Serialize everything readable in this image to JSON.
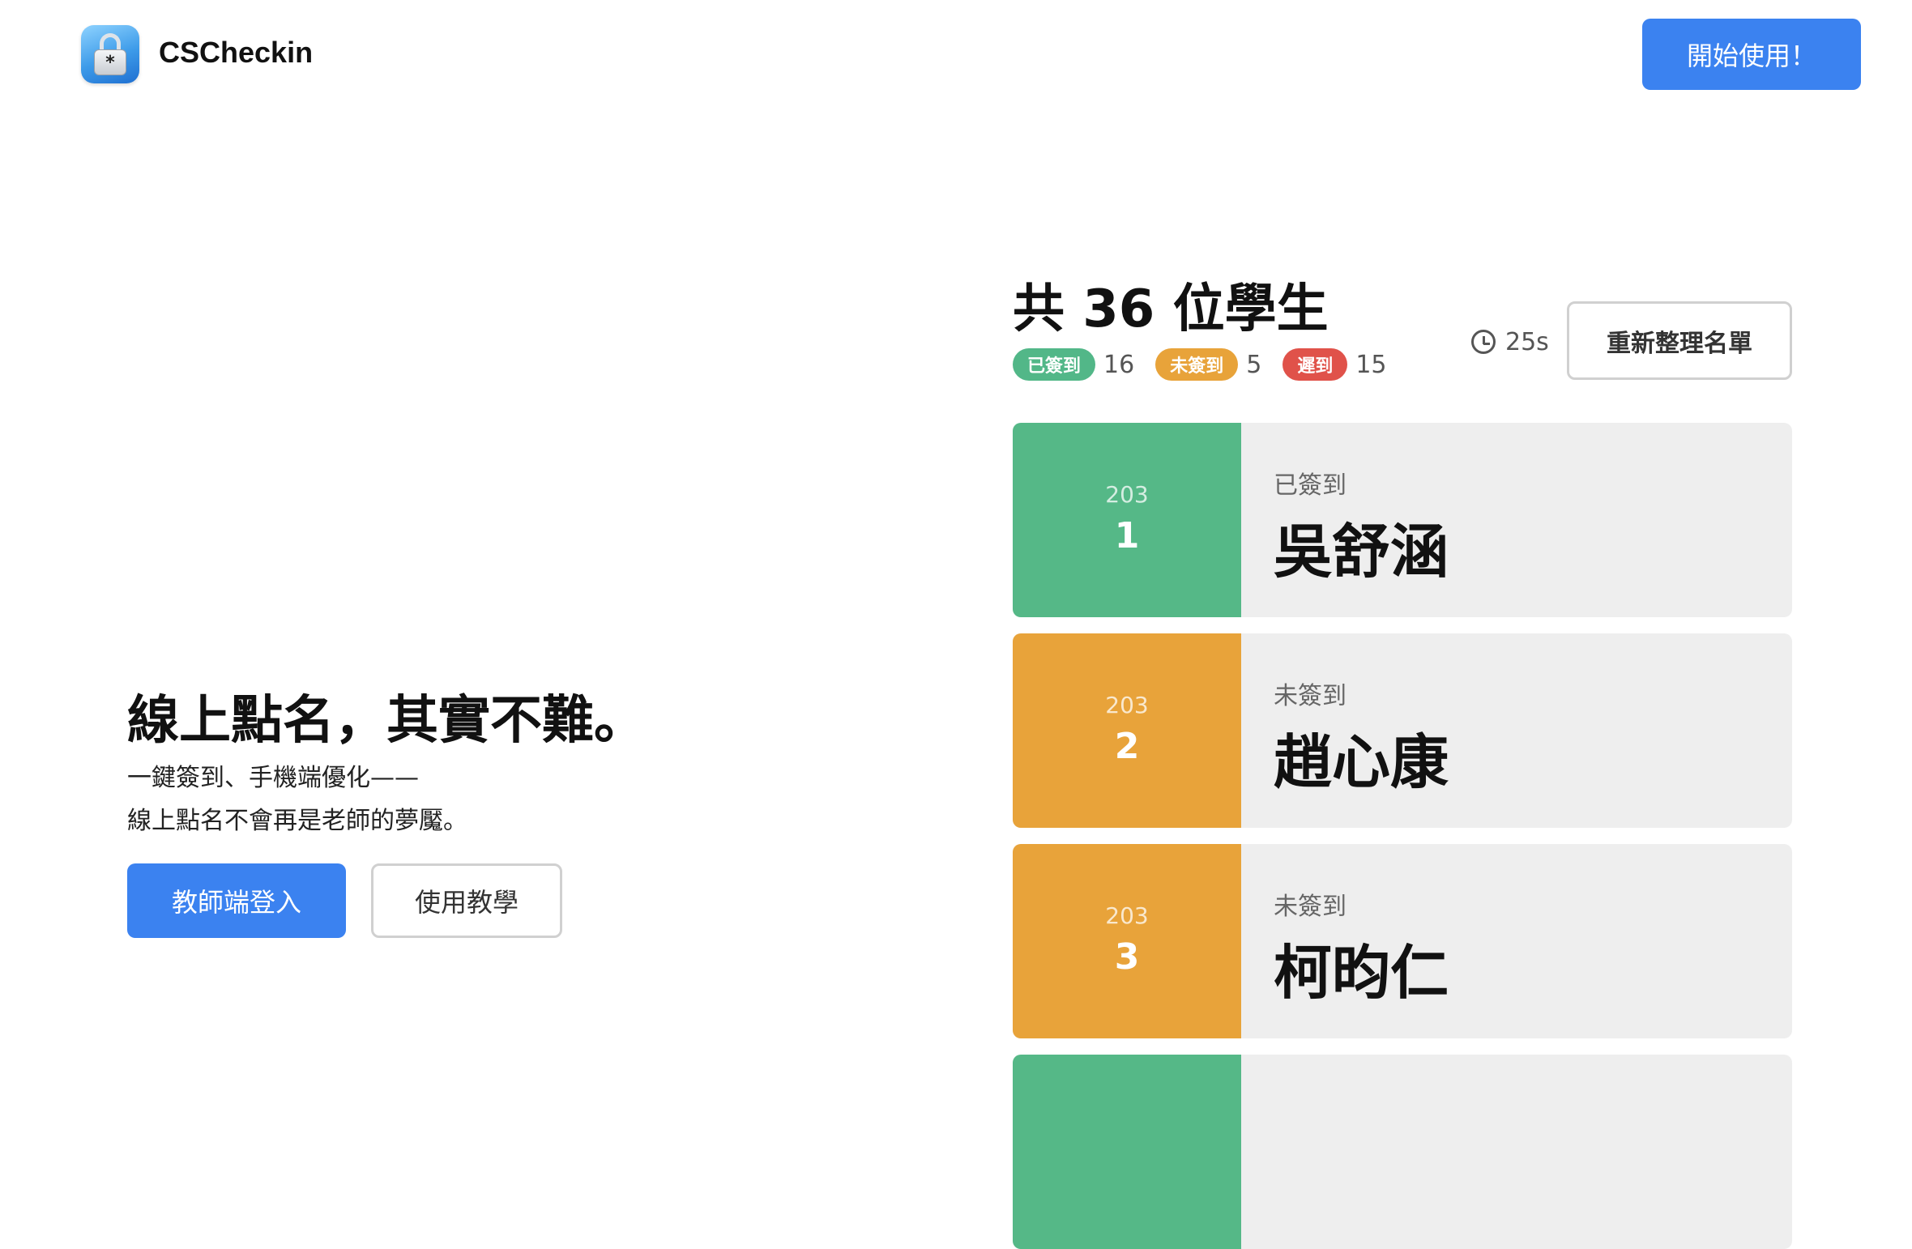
{
  "header": {
    "brand": "CSCheckin",
    "start_label": "開始使用！"
  },
  "hero": {
    "title": "線上點名，其實不難。",
    "subtitle_line1": "一鍵簽到、手機端優化——",
    "subtitle_line2": "線上點名不會再是老師的夢魘。",
    "login_label": "教師端登入",
    "tutorial_label": "使用教學"
  },
  "panel": {
    "title": "共 36 位學生",
    "stats": [
      {
        "label": "已簽到",
        "count": "16",
        "color": "#52b788"
      },
      {
        "label": "未簽到",
        "count": "5",
        "color": "#e8a33a"
      },
      {
        "label": "遲到",
        "count": "15",
        "color": "#e0524a"
      }
    ],
    "timer": "25s",
    "refresh_label": "重新整理名單",
    "students": [
      {
        "class": "203",
        "seat": "1",
        "status": "已簽到",
        "name": "吳舒涵",
        "color": "#55b887"
      },
      {
        "class": "203",
        "seat": "2",
        "status": "未簽到",
        "name": "趙心康",
        "color": "#e8a33a"
      },
      {
        "class": "203",
        "seat": "3",
        "status": "未簽到",
        "name": "柯昀仁",
        "color": "#e8a33a"
      },
      {
        "class": "",
        "seat": "",
        "status": "",
        "name": "",
        "color": "#55b887"
      }
    ]
  },
  "icons": {
    "logo": "padlock-icon",
    "timer": "alarm-clock-icon"
  }
}
